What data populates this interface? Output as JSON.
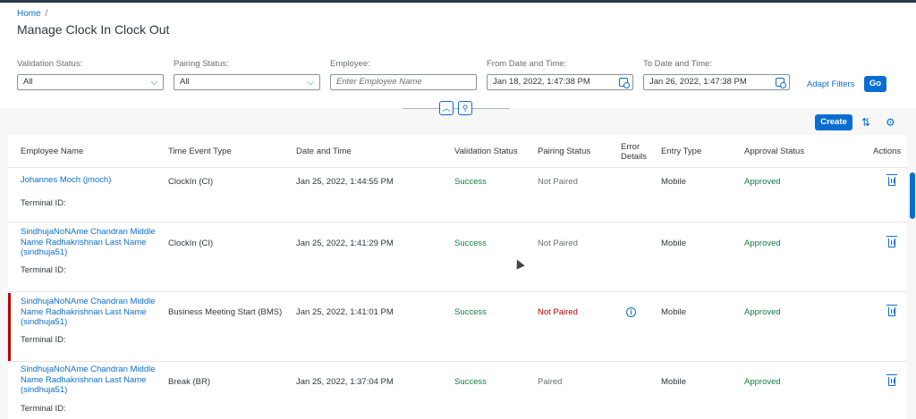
{
  "breadcrumb": {
    "home": "Home",
    "separator": "/"
  },
  "page_title": "Manage Clock In Clock Out",
  "filters": {
    "validation_status": {
      "label": "Validation Status:",
      "value": "All"
    },
    "pairing_status": {
      "label": "Pairing Status:",
      "value": "All"
    },
    "employee": {
      "label": "Employee:",
      "placeholder": "Enter Employee Name"
    },
    "from_date": {
      "label": "From Date and Time:",
      "value": "Jan 18, 2022, 1:47:38 PM"
    },
    "to_date": {
      "label": "To Date and Time:",
      "value": "Jan 26, 2022, 1:47:38 PM"
    },
    "adapt_filters": "Adapt Filters",
    "go": "Go"
  },
  "toolbar": {
    "create": "Create"
  },
  "icons": {
    "collapse": "chevron-up-icon",
    "pin": "pin-icon",
    "sort": "sort-icon",
    "settings": "gear-icon",
    "delete": "trash-icon",
    "info": "info-icon",
    "calendar": "calendar-icon"
  },
  "colors": {
    "accent": "#0a6ed1",
    "success": "#107e3e",
    "error": "#bb0000"
  },
  "table": {
    "columns": {
      "employee": "Employee Name",
      "event": "Time Event Type",
      "date": "Date and Time",
      "validation": "Validation Status",
      "pairing": "Pairing Status",
      "error1": "Error",
      "error2": "Details",
      "entry": "Entry Type",
      "approval": "Approval Status",
      "actions": "Actions"
    },
    "rows": [
      {
        "name_lines": [
          "Johannes Moch (jmoch)"
        ],
        "terminal": "Terminal ID:",
        "event": "ClockIn (CI)",
        "date": "Jan 25, 2022, 1:44:55 PM",
        "validation": "Success",
        "pairing": "Not Paired",
        "entry": "Mobile",
        "approval": "Approved"
      },
      {
        "name_lines": [
          "SindhujaNoNAme Chandran Middle",
          "Name Radhakrishnan Last Name",
          "(sindhuja51)"
        ],
        "terminal": "Terminal ID:",
        "event": "ClockIn (CI)",
        "date": "Jan 25, 2022, 1:41:29 PM",
        "validation": "Success",
        "pairing": "Not Paired",
        "entry": "Mobile",
        "approval": "Approved"
      },
      {
        "name_lines": [
          "SindhujaNoNAme Chandran Middle",
          "Name Radhakrishnan Last Name",
          "(sindhuja51)"
        ],
        "terminal": "Terminal ID:",
        "event": "Business Meeting Start (BMS)",
        "date": "Jan 25, 2022, 1:41:01 PM",
        "validation": "Success",
        "pairing": "Not Paired",
        "entry": "Mobile",
        "approval": "Approved"
      },
      {
        "name_lines": [
          "SindhujaNoNAme Chandran Middle",
          "Name Radhakrishnan Last Name",
          "(sindhuja51)"
        ],
        "terminal": "Terminal ID:",
        "event": "Break (BR)",
        "date": "Jan 25, 2022, 1:37:04 PM",
        "validation": "Success",
        "pairing": "Paired",
        "entry": "Mobile",
        "approval": "Approved"
      }
    ]
  }
}
